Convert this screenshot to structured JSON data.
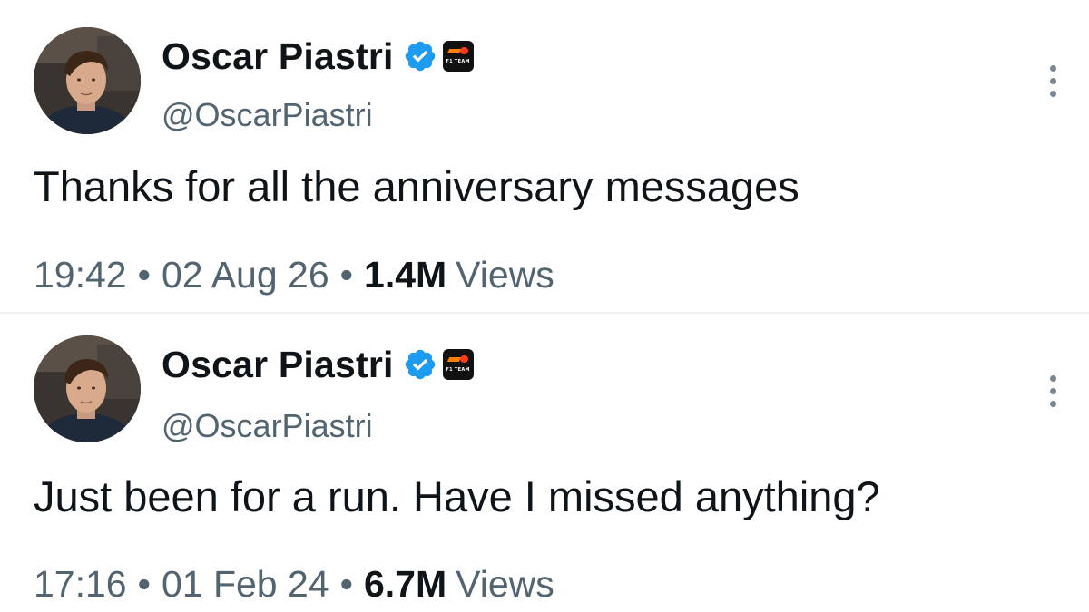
{
  "tweets": [
    {
      "author_name": "Oscar Piastri",
      "handle": "@OscarPiastri",
      "team_badge_text": "F1 TEAM",
      "text": "Thanks for all the anniversary messages",
      "time": "19:42",
      "date": "02 Aug 26",
      "views_count": "1.4M",
      "views_label": "Views"
    },
    {
      "author_name": "Oscar Piastri",
      "handle": "@OscarPiastri",
      "team_badge_text": "F1 TEAM",
      "text": "Just been for a run. Have I missed anything?",
      "time": "17:16",
      "date": "01 Feb 24",
      "views_count": "6.7M",
      "views_label": "Views"
    }
  ],
  "meta_separator": "•",
  "colors": {
    "text_primary": "#0f1419",
    "text_secondary": "#536471",
    "verified_blue": "#1d9bf0",
    "team_orange": "#ff8000"
  },
  "icons": {
    "verified": "verified-badge-icon",
    "team": "mclaren-team-badge-icon",
    "more": "more-options-icon"
  }
}
